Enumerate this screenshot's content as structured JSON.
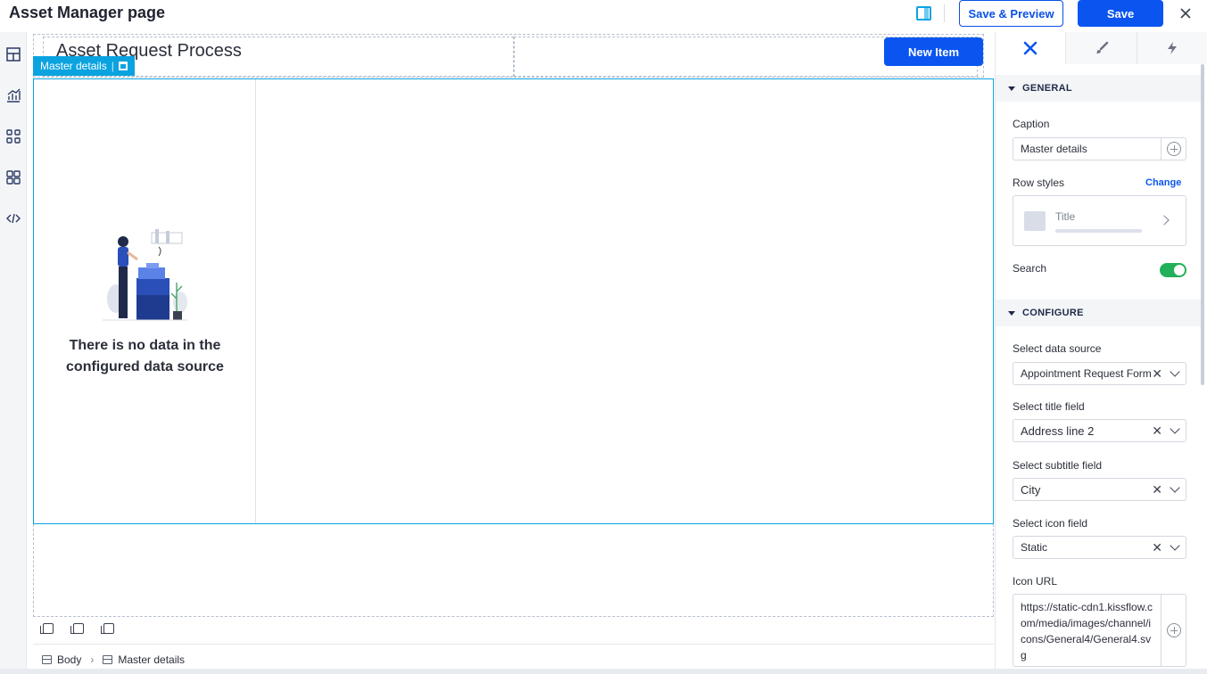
{
  "header": {
    "page_title": "Asset Manager page",
    "save_preview_label": "Save & Preview",
    "save_label": "Save"
  },
  "canvas": {
    "process_title": "Asset Request Process",
    "new_item_label": "New Item",
    "component_tag": "Master details",
    "tag_separator": "|",
    "empty_message": "There is no data in the configured data source",
    "breadcrumb": [
      "Body",
      "Master details"
    ]
  },
  "panel": {
    "general_header": "GENERAL",
    "caption_label": "Caption",
    "caption_value": "Master details",
    "row_styles_label": "Row styles",
    "change_label": "Change",
    "row_style_title": "Title",
    "search_label": "Search",
    "search_enabled": true,
    "configure_header": "CONFIGURE",
    "data_source_label": "Select data source",
    "data_source_value": "Appointment Request Form",
    "title_field_label": "Select title field",
    "title_field_value": "Address line 2",
    "subtitle_field_label": "Select subtitle field",
    "subtitle_field_value": "City",
    "icon_field_label": "Select icon field",
    "icon_field_value": "Static",
    "icon_url_label": "Icon URL",
    "icon_url_value": "https://static-cdn1.kissflow.com/media/images/channel/icons/General4/General4.svg"
  },
  "colors": {
    "primary": "#0a55f0",
    "selection": "#0aa3e0",
    "toggle_on": "#22b05a"
  }
}
